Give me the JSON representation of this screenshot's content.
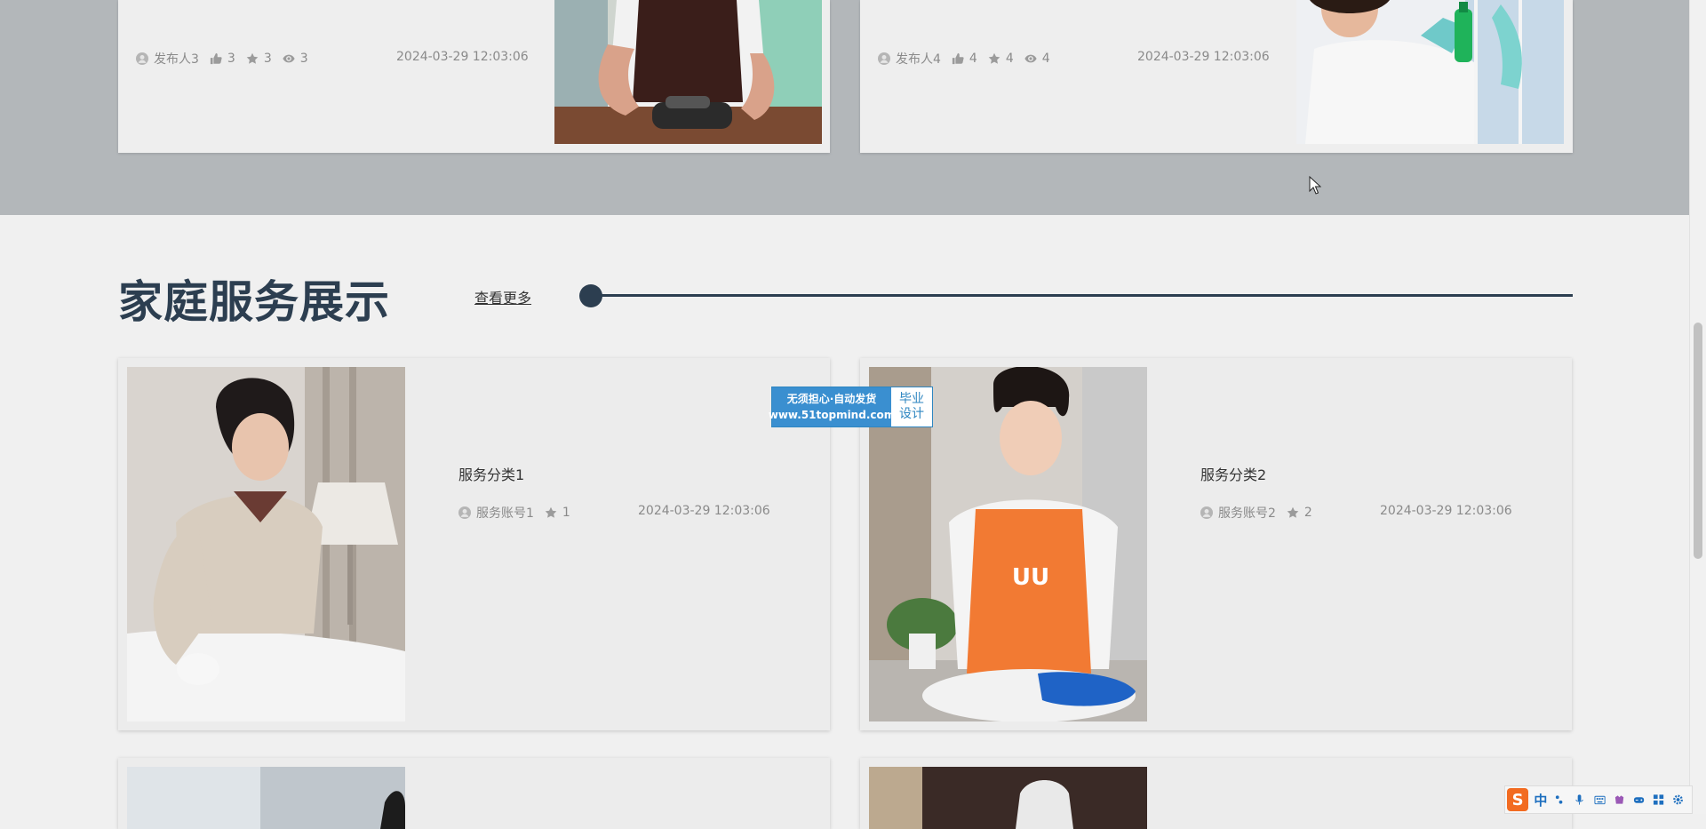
{
  "news": [
    {
      "publisher": "发布人3",
      "likes": "3",
      "favorites": "3",
      "views": "3",
      "date": "2024-03-29 12:03:06"
    },
    {
      "publisher": "发布人4",
      "likes": "4",
      "favorites": "4",
      "views": "4",
      "date": "2024-03-29 12:03:06"
    }
  ],
  "section": {
    "title": "家庭服务展示",
    "more": "查看更多"
  },
  "services": [
    {
      "name": "服务分类1",
      "account": "服务账号1",
      "favorites": "1",
      "date": "2024-03-29 12:03:06"
    },
    {
      "name": "服务分类2",
      "account": "服务账号2",
      "favorites": "2",
      "date": "2024-03-29 12:03:06"
    }
  ],
  "badge": {
    "line1": "无须担心·自动发货",
    "line2": "www.51topmind.com",
    "right1": "毕业",
    "right2": "设计"
  },
  "ime": {
    "logo": "S",
    "mode": "中"
  },
  "colors": {
    "accent": "#2c3e50",
    "band": "#b3b7ba",
    "badge": "#3a8fd0",
    "ime_logo": "#f26b21"
  }
}
